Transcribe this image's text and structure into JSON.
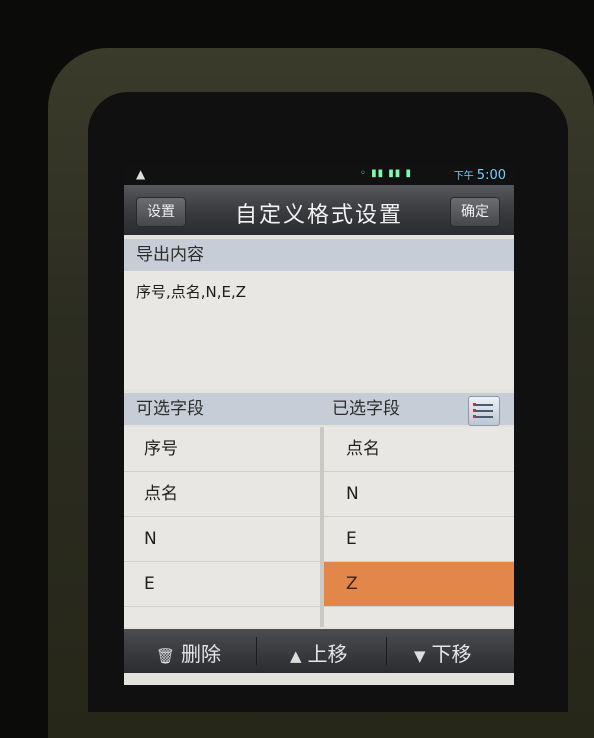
{
  "status_bar": {
    "warning_glyph": "▲",
    "signal_glyph": "◦ ▮▮ ▮▮ ▮",
    "ampm": "下午",
    "time": "5:00"
  },
  "title_bar": {
    "left_button": "设置",
    "title": "自定义格式设置",
    "right_button": "确定"
  },
  "export": {
    "header": "导出内容",
    "content": "序号,点名,N,E,Z"
  },
  "fields": {
    "available_header": "可选字段",
    "selected_header": "已选字段",
    "available": [
      "序号",
      "点名",
      "N",
      "E"
    ],
    "selected": [
      "点名",
      "N",
      "E",
      "Z"
    ],
    "selected_index": 3,
    "highlight_color": "#e3864a"
  },
  "bottom_bar": {
    "delete": "删除",
    "up": "上移",
    "down": "下移"
  },
  "icons": {
    "delete": "trash-icon",
    "up": "triangle-up-icon",
    "down": "triangle-down-icon",
    "list": "list-options-icon"
  }
}
